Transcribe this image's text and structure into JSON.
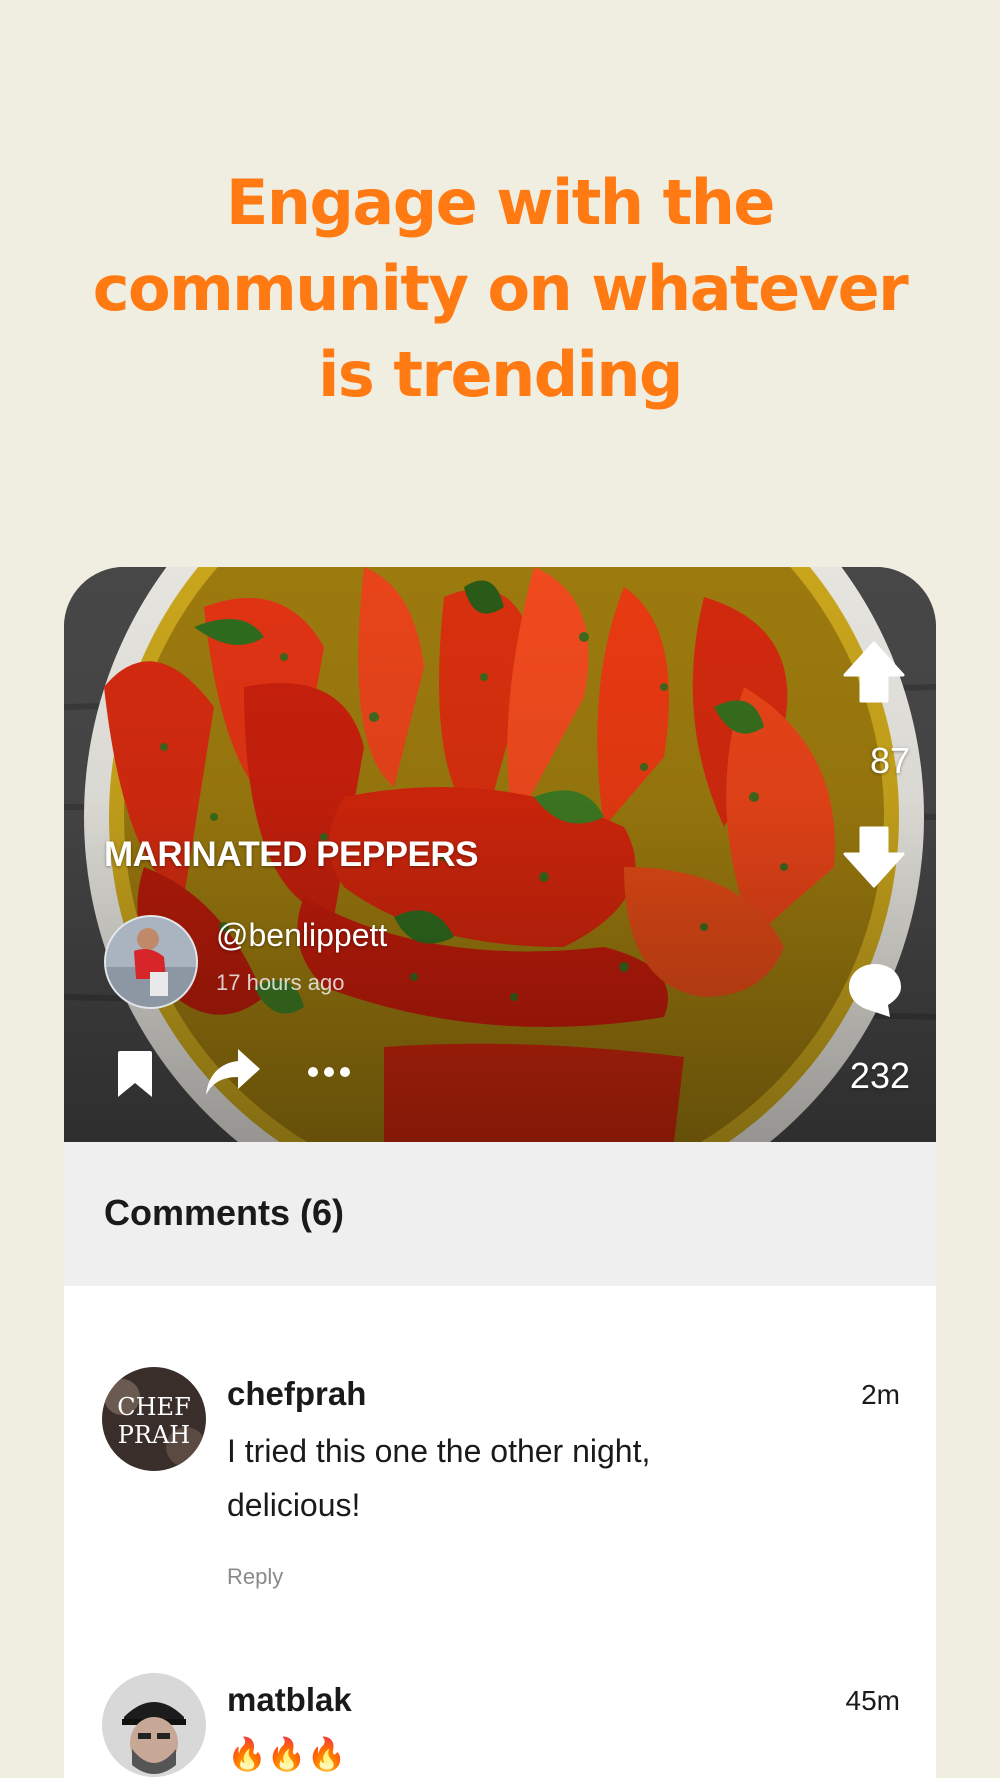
{
  "headline": "Engage with the community on whatever is trending",
  "post": {
    "title": "MARINATED PEPPERS",
    "handle": "@benlippett",
    "time_ago": "17 hours ago",
    "votes": "87",
    "comment_count": "232"
  },
  "comments_section": {
    "title": "Comments (6)",
    "items": [
      {
        "user": "chefprah",
        "avatar_text": "CHEF PRAH",
        "time": "2m",
        "text": "I tried this one the other night, delicious!",
        "reply_label": "Reply"
      },
      {
        "user": "matblak",
        "time": "45m",
        "text": "🔥🔥🔥"
      }
    ]
  },
  "colors": {
    "accent": "#ff7a12",
    "background": "#f0ede1",
    "comments_header_bg": "#efefef"
  },
  "icons": [
    "upvote-icon",
    "downvote-icon",
    "comment-icon",
    "bookmark-icon",
    "share-icon",
    "more-icon"
  ]
}
